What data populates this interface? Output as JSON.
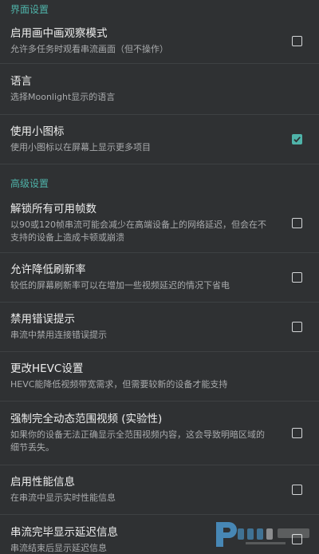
{
  "sections": {
    "interface": {
      "header": "界面设置"
    },
    "advanced": {
      "header": "高级设置"
    }
  },
  "items": {
    "pip": {
      "title": "启用画中画观察模式",
      "summary": "允许多任务时观看串流画面（但不操作）",
      "checked": false
    },
    "language": {
      "title": "语言",
      "summary": "选择Moonlight显示的语言"
    },
    "small_icons": {
      "title": "使用小图标",
      "summary": "使用小图标以在屏幕上显示更多项目",
      "checked": true
    },
    "unlock_fps": {
      "title": "解锁所有可用帧数",
      "summary": "以90或120帧串流可能会减少在高端设备上的网络延迟，但会在不支持的设备上造成卡顿或崩溃",
      "checked": false
    },
    "reduce_refresh": {
      "title": "允许降低刷新率",
      "summary": "较低的屏幕刷新率可以在增加一些视频延迟的情况下省电",
      "checked": false
    },
    "disable_errors": {
      "title": "禁用错误提示",
      "summary": "串流中禁用连接错误提示",
      "checked": false
    },
    "hevc": {
      "title": "更改HEVC设置",
      "summary": "HEVC能降低视频带宽需求，但需要较新的设备才能支持"
    },
    "hdr": {
      "title": "强制完全动态范围视频 (实验性)",
      "summary": "如果你的设备无法正确显示全范围视频内容，这会导致明暗区域的细节丢失。",
      "checked": false
    },
    "perf_overlay": {
      "title": "启用性能信息",
      "summary": "在串流中显示实时性能信息",
      "checked": false
    },
    "latency_toast": {
      "title": "串流完毕显示延迟信息",
      "summary": "串流结束后显示延迟信息",
      "checked": false
    }
  },
  "colors": {
    "background": "#2f3133",
    "accent": "#4fb3a9",
    "divider": "#3e4143"
  }
}
